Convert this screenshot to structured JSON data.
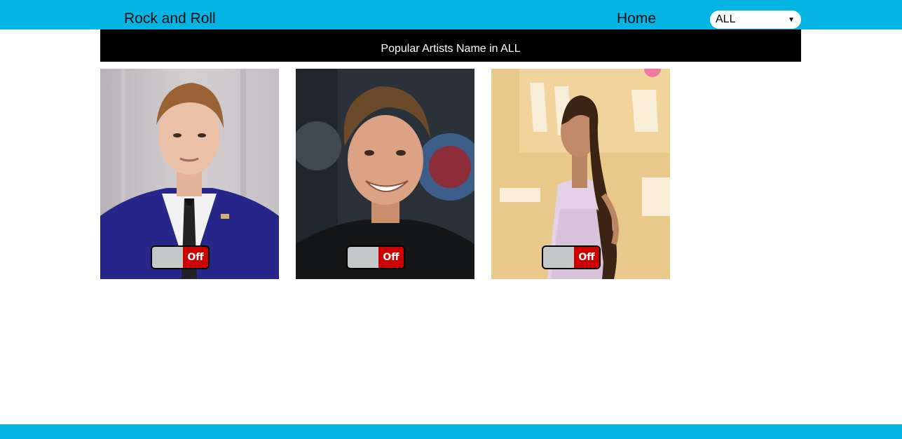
{
  "header": {
    "brand": "Rock and Roll",
    "nav_home": "Home",
    "genre_select": {
      "value": "ALL"
    }
  },
  "banner": {
    "text": "Popular Artists Name in ALL"
  },
  "cards": [
    {
      "photo": "artist-photo-1",
      "toggle_label": "Off"
    },
    {
      "photo": "artist-photo-2",
      "toggle_label": "Off"
    },
    {
      "photo": "artist-photo-3",
      "toggle_label": "Off"
    }
  ],
  "colors": {
    "accent": "#04b4e4",
    "banner_bg": "#000000",
    "toggle_off": "#cc0000",
    "toggle_track": "#c4c8c8"
  }
}
